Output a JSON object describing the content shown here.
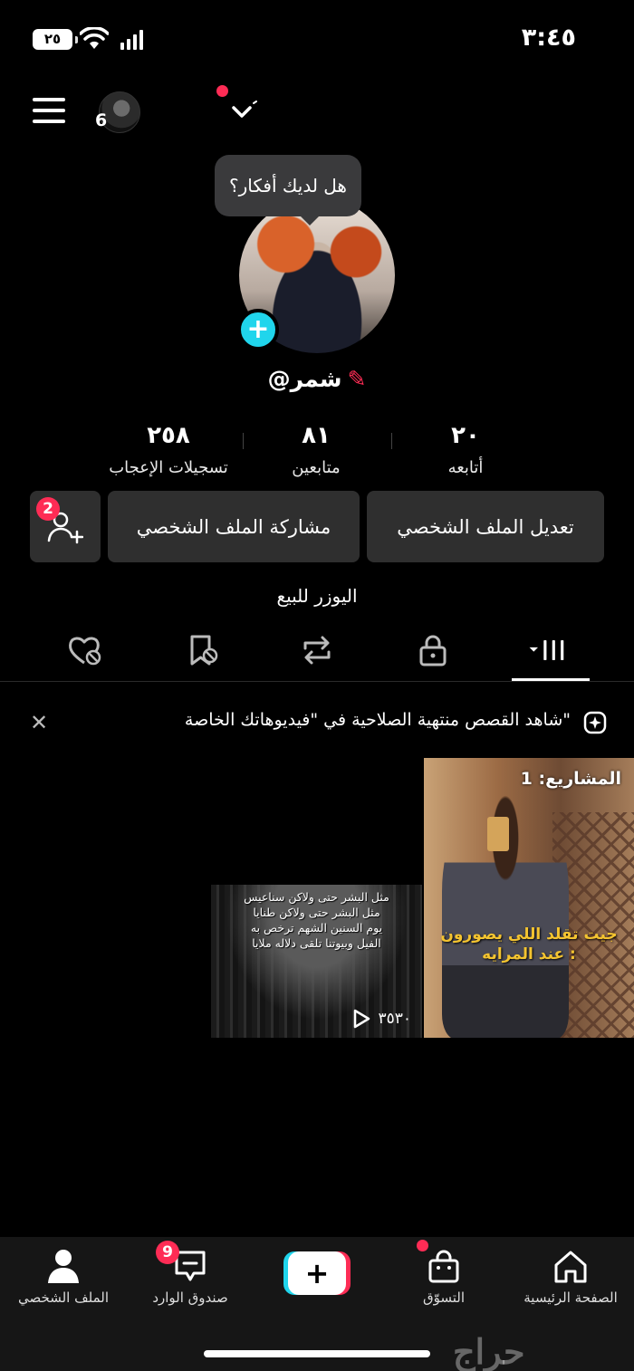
{
  "status_bar": {
    "time": "٣:٤٥",
    "battery": "٢٥"
  },
  "top_bar": {
    "account_count": "6"
  },
  "profile": {
    "thoughts_prompt": "هل لديك أفكار؟",
    "username": "@شمر",
    "stats": [
      {
        "value": "٢٠",
        "label": "أتابعه"
      },
      {
        "value": "٨١",
        "label": "متابعين"
      },
      {
        "value": "٢٥٨",
        "label": "تسجيلات الإعجاب"
      }
    ],
    "edit_profile_label": "تعديل الملف الشخصي",
    "share_profile_label": "مشاركة الملف الشخصي",
    "friend_requests_badge": "2",
    "bio": "اليوزر للبيع"
  },
  "tabs": [
    "videos-grid-icon",
    "lock-icon",
    "repost-icon",
    "favorites-icon",
    "liked-icon"
  ],
  "banner": {
    "text": "شاهد القصص منتهية الصلاحية في \"فيديوهاتك الخاصة\""
  },
  "videos": [
    {
      "pinned_label": "المشاريع: 1",
      "caption": "جيت تقلد اللي يصورون عند المرايه :"
    },
    {
      "caption_lines": [
        "مثل البشر حتى ولاكن سناعيس",
        "مثل البشر حتى ولاكن طنايا",
        "يوم السنين الشهم ترخص به",
        "الفيل وبيوتنا تلقى دلاله ملايا"
      ],
      "views": "٣٥٣٠"
    }
  ],
  "bottom_nav": {
    "home": "الصفحة الرئيسية",
    "shop": "التسوّق",
    "inbox": "صندوق الوارد",
    "inbox_badge": "9",
    "profile": "الملف الشخصي"
  },
  "watermark": "حراج",
  "colors": {
    "accent_pink": "#fe2c55",
    "accent_cyan": "#20d5ec",
    "button_bg": "#2f2f2f"
  }
}
